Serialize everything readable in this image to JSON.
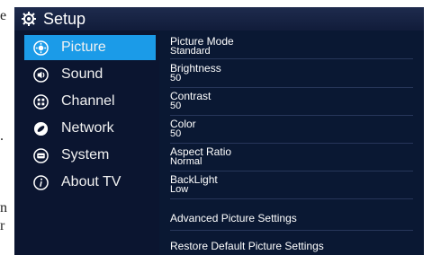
{
  "edge_text": [
    "e",
    ".",
    "n",
    "r"
  ],
  "header": {
    "title": "Setup",
    "icon": "gear-icon"
  },
  "sidebar": {
    "items": [
      {
        "label": "Picture",
        "icon": "picture-icon",
        "selected": true
      },
      {
        "label": "Sound",
        "icon": "speaker-icon",
        "selected": false
      },
      {
        "label": "Channel",
        "icon": "channel-icon",
        "selected": false
      },
      {
        "label": "Network",
        "icon": "network-icon",
        "selected": false
      },
      {
        "label": "System",
        "icon": "system-icon",
        "selected": false
      },
      {
        "label": "About TV",
        "icon": "info-icon",
        "selected": false
      }
    ]
  },
  "settings": [
    {
      "name": "Picture Mode",
      "value": "Standard"
    },
    {
      "name": "Brightness",
      "value": "50"
    },
    {
      "name": "Contrast",
      "value": "50"
    },
    {
      "name": "Color",
      "value": "50"
    },
    {
      "name": "Aspect Ratio",
      "value": "Normal"
    },
    {
      "name": "BackLight",
      "value": "Low"
    }
  ],
  "actions": {
    "advanced": "Advanced Picture Settings",
    "restore": "Restore Default Picture Settings"
  },
  "colors": {
    "selected": "#1b9be8",
    "background": "#0b1530"
  }
}
